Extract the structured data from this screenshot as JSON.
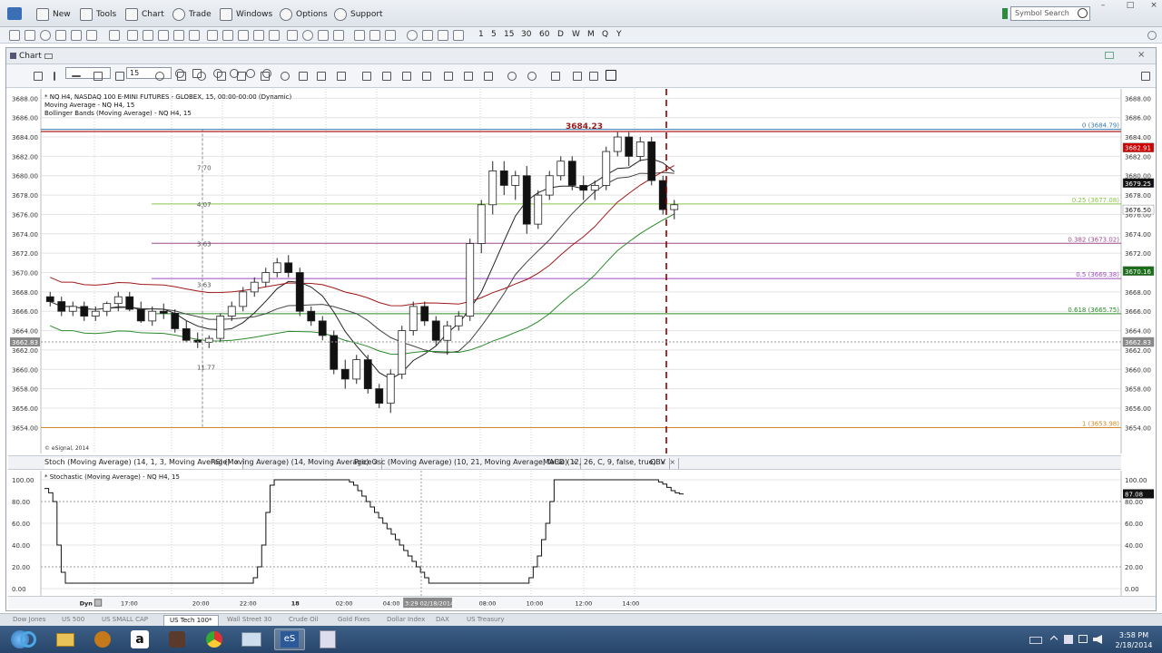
{
  "menubar": {
    "items": [
      {
        "label": "New",
        "icon": "new-icon"
      },
      {
        "label": "Tools",
        "icon": "tools-icon"
      },
      {
        "label": "Chart",
        "icon": "chart-icon"
      },
      {
        "label": "Trade",
        "icon": "trade-icon"
      },
      {
        "label": "Windows",
        "icon": "windows-icon"
      },
      {
        "label": "Options",
        "icon": "gear-icon"
      },
      {
        "label": "Support",
        "icon": "help-icon"
      }
    ],
    "search_placeholder": "Symbol Search"
  },
  "intervals": [
    "1",
    "5",
    "15",
    "30",
    "60",
    "D",
    "W",
    "M",
    "Q",
    "Y"
  ],
  "chart_window": {
    "title": "Chart",
    "interval_value": "15"
  },
  "legend": {
    "line1": "* NQ H4, NASDAQ 100 E-MINI FUTURES - GLOBEX, 15, 00:00-00:00 (Dynamic)",
    "line2": "Moving Average - NQ H4, 15",
    "line3": "Bollinger Bands (Moving Average) - NQ H4, 15",
    "copyright": "© eSignal, 2014"
  },
  "price_axis": {
    "ticks": [
      "3688.00",
      "3686.00",
      "3684.00",
      "3682.00",
      "3680.00",
      "3678.00",
      "3676.00",
      "3674.00",
      "3672.00",
      "3670.00",
      "3668.00",
      "3666.00",
      "3664.00",
      "3662.00",
      "3660.00",
      "3658.00",
      "3656.00",
      "3654.00"
    ],
    "markers": [
      {
        "label": "3682.91",
        "color": "#cc0000"
      },
      {
        "label": "3679.25",
        "color": "#111111"
      },
      {
        "label": "3676.50",
        "color": "#ffffff"
      },
      {
        "label": "3670.16",
        "color": "#1a6e1a"
      },
      {
        "label": "3662.83",
        "color": "#888888"
      }
    ]
  },
  "fib_levels": [
    {
      "label": "0 (3684.79)",
      "color": "#3a7ab0"
    },
    {
      "label": "0.25 (3677.08)",
      "color": "#8ac44a"
    },
    {
      "label": "0.382 (3673.02)",
      "color": "#9c4a8a"
    },
    {
      "label": "0.5 (3669.38)",
      "color": "#9c4ac4"
    },
    {
      "label": "0.618 (3665.75)",
      "color": "#2a8a2a"
    },
    {
      "label": "1 (3653.98)",
      "color": "#d08a2a"
    }
  ],
  "annotations": {
    "high_label": "3684.23",
    "measure_labels": [
      "7.70",
      "4.07",
      "3.63",
      "3.63",
      "11.77"
    ]
  },
  "osc_tabs": [
    "Stoch (Moving Average) (14, 1, 3, Moving Average)",
    "RSI (Moving Average) (14, Moving Average)",
    "PriceOsc (Moving Average) (10, 21, Moving Average, false)",
    "MACD (12, 26, C, 9, false, true)",
    "OBV"
  ],
  "osc": {
    "title": "* Stochastic (Moving Average) - NQ H4, 15",
    "ticks": [
      "100.00",
      "80.00",
      "60.00",
      "40.00",
      "20.00",
      "0.00"
    ],
    "left_ticks": [
      "100.00",
      "80.00",
      "60.00",
      "40.00",
      "20.00",
      "0.00"
    ],
    "marker": "87.08"
  },
  "time_axis": {
    "label": "Dyn",
    "ticks": [
      "17:00",
      "20:00",
      "22:00",
      "18",
      "02:00",
      "04:00",
      "08:00",
      "10:00",
      "12:00",
      "14:00"
    ],
    "cursor": "3:29 02/18/2014"
  },
  "page_tabs": [
    "Dow Jones",
    "US 500",
    "US SMALL CAP",
    "US Tech 100*",
    "Wall Street 30",
    "Crude Oil",
    "Gold Fixes",
    "Dollar Index",
    "DAX",
    "US Treasury"
  ],
  "clock": {
    "time": "3:58 PM",
    "date": "2/18/2014"
  },
  "chart_data": {
    "type": "candlestick",
    "symbol": "NQ H4",
    "interval": "15",
    "ylim": [
      3653,
      3688.5
    ],
    "x": [
      "17:00",
      "20:00",
      "22:00",
      "18",
      "02:00",
      "04:00",
      "08:00",
      "10:00",
      "12:00",
      "14:00"
    ],
    "ohlc": [
      [
        3667.5,
        3668.0,
        3666.5,
        3667.0
      ],
      [
        3667.0,
        3667.5,
        3665.5,
        3666.0
      ],
      [
        3666.0,
        3667.0,
        3665.5,
        3666.5
      ],
      [
        3666.5,
        3667.0,
        3665.0,
        3665.5
      ],
      [
        3665.5,
        3666.5,
        3665.0,
        3666.0
      ],
      [
        3666.0,
        3667.0,
        3665.5,
        3666.8
      ],
      [
        3666.8,
        3668.0,
        3666.0,
        3667.5
      ],
      [
        3667.5,
        3668.0,
        3666.0,
        3666.2
      ],
      [
        3666.2,
        3667.0,
        3664.8,
        3665.0
      ],
      [
        3665.0,
        3666.5,
        3664.5,
        3666.0
      ],
      [
        3666.0,
        3666.8,
        3665.2,
        3665.8
      ],
      [
        3665.8,
        3666.2,
        3663.8,
        3664.2
      ],
      [
        3664.2,
        3665.0,
        3662.8,
        3663.0
      ],
      [
        3663.0,
        3663.8,
        3662.2,
        3662.8
      ],
      [
        3662.8,
        3663.5,
        3662.2,
        3663.2
      ],
      [
        3663.2,
        3665.8,
        3662.8,
        3665.5
      ],
      [
        3665.5,
        3667.0,
        3665.0,
        3666.5
      ],
      [
        3666.5,
        3668.5,
        3666.0,
        3668.0
      ],
      [
        3668.0,
        3669.5,
        3667.5,
        3669.0
      ],
      [
        3669.0,
        3670.5,
        3668.5,
        3670.0
      ],
      [
        3670.0,
        3671.5,
        3669.5,
        3671.0
      ],
      [
        3671.0,
        3671.8,
        3669.5,
        3670.0
      ],
      [
        3670.0,
        3670.5,
        3665.5,
        3666.0
      ],
      [
        3666.0,
        3666.5,
        3664.5,
        3665.0
      ],
      [
        3665.0,
        3665.5,
        3663.0,
        3663.5
      ],
      [
        3663.5,
        3664.0,
        3659.5,
        3660.0
      ],
      [
        3660.0,
        3661.0,
        3658.0,
        3659.0
      ],
      [
        3659.0,
        3661.5,
        3658.5,
        3661.0
      ],
      [
        3661.0,
        3661.5,
        3657.5,
        3658.0
      ],
      [
        3658.0,
        3658.5,
        3656.0,
        3656.5
      ],
      [
        3656.5,
        3660.0,
        3655.5,
        3659.5
      ],
      [
        3659.5,
        3664.5,
        3659.0,
        3664.0
      ],
      [
        3664.0,
        3667.0,
        3663.5,
        3666.5
      ],
      [
        3666.5,
        3667.0,
        3664.5,
        3665.0
      ],
      [
        3665.0,
        3665.5,
        3662.5,
        3663.0
      ],
      [
        3663.0,
        3665.0,
        3661.5,
        3664.5
      ],
      [
        3664.5,
        3666.0,
        3664.0,
        3665.5
      ],
      [
        3665.5,
        3673.5,
        3665.0,
        3673.0
      ],
      [
        3673.0,
        3677.5,
        3672.0,
        3677.0
      ],
      [
        3677.0,
        3681.5,
        3676.0,
        3680.5
      ],
      [
        3680.5,
        3681.5,
        3678.0,
        3679.0
      ],
      [
        3679.0,
        3680.5,
        3677.5,
        3680.0
      ],
      [
        3680.0,
        3681.0,
        3674.0,
        3675.0
      ],
      [
        3675.0,
        3678.5,
        3674.5,
        3678.0
      ],
      [
        3678.0,
        3680.5,
        3677.5,
        3680.0
      ],
      [
        3680.0,
        3682.0,
        3679.5,
        3681.5
      ],
      [
        3681.5,
        3682.0,
        3678.5,
        3679.0
      ],
      [
        3679.0,
        3680.0,
        3677.5,
        3678.5
      ],
      [
        3678.5,
        3679.5,
        3677.5,
        3679.0
      ],
      [
        3679.0,
        3683.0,
        3678.5,
        3682.5
      ],
      [
        3682.5,
        3684.5,
        3682.0,
        3684.0
      ],
      [
        3684.0,
        3684.5,
        3681.0,
        3682.0
      ],
      [
        3682.0,
        3684.0,
        3681.5,
        3683.5
      ],
      [
        3683.5,
        3684.0,
        3679.0,
        3679.5
      ],
      [
        3679.5,
        3680.0,
        3676.0,
        3676.5
      ],
      [
        3676.5,
        3677.5,
        3675.5,
        3677.0
      ]
    ],
    "fibonacci": [
      {
        "level": 0,
        "price": 3684.79
      },
      {
        "level": 0.25,
        "price": 3677.08
      },
      {
        "level": 0.382,
        "price": 3673.02
      },
      {
        "level": 0.5,
        "price": 3669.38
      },
      {
        "level": 0.618,
        "price": 3665.75
      },
      {
        "level": 1,
        "price": 3653.98
      }
    ],
    "horizontal_lines": [
      3684.23
    ],
    "stochastic": [
      92,
      88,
      80,
      40,
      15,
      5,
      5,
      5,
      5,
      5,
      5,
      5,
      5,
      5,
      5,
      5,
      5,
      5,
      5,
      5,
      5,
      5,
      5,
      5,
      5,
      5,
      5,
      5,
      5,
      5,
      5,
      5,
      5,
      5,
      5,
      5,
      5,
      5,
      5,
      5,
      5,
      5,
      5,
      5,
      5,
      5,
      5,
      5,
      5,
      5,
      10,
      20,
      40,
      70,
      95,
      100,
      100,
      100,
      100,
      100,
      100,
      100,
      100,
      100,
      100,
      100,
      100,
      100,
      100,
      100,
      100,
      100,
      100,
      98,
      95,
      90,
      85,
      80,
      75,
      70,
      65,
      60,
      55,
      50,
      45,
      40,
      35,
      30,
      25,
      20,
      15,
      10,
      5,
      5,
      5,
      5,
      5,
      5,
      5,
      5,
      5,
      5,
      5,
      5,
      5,
      5,
      5,
      5,
      5,
      5,
      5,
      5,
      5,
      5,
      5,
      5,
      10,
      20,
      30,
      45,
      60,
      80,
      100,
      100,
      100,
      100,
      100,
      100,
      100,
      100,
      100,
      100,
      100,
      100,
      100,
      100,
      100,
      100,
      100,
      100,
      100,
      100,
      100,
      100,
      100,
      100,
      100,
      98,
      96,
      93,
      90,
      88,
      87
    ]
  }
}
